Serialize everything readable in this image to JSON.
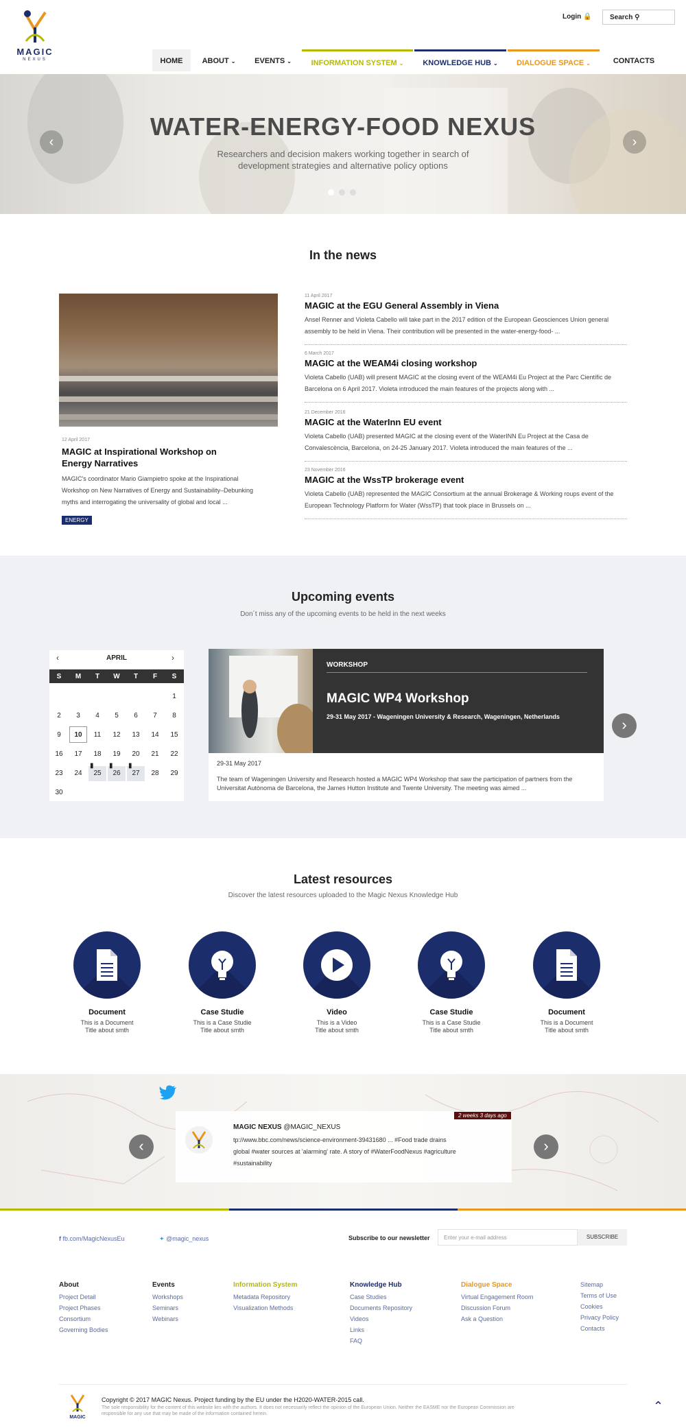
{
  "header": {
    "logo_word": "MAGIC",
    "logo_sub": "NEXUS",
    "login_label": "Login",
    "search_label": "Search",
    "nav": [
      {
        "label": "HOME",
        "color": "#222222"
      },
      {
        "label": "ABOUT",
        "color": "#222222"
      },
      {
        "label": "EVENTS",
        "color": "#222222"
      },
      {
        "label": "INFORMATION SYSTEM",
        "color": "#b7b900"
      },
      {
        "label": "KNOWLEDGE HUB",
        "color": "#1c2d6b"
      },
      {
        "label": "DIALOGUE SPACE",
        "color": "#e8961e"
      },
      {
        "label": "CONTACTS",
        "color": "#222222"
      }
    ]
  },
  "hero": {
    "title": "WATER-ENERGY-FOOD NEXUS",
    "subtitle": "Researchers and decision makers working together in search of development strategies and alternative policy options",
    "slide_current": 1,
    "slide_count": 3
  },
  "news": {
    "title": "In the news",
    "featured": {
      "date": "12 April 2017",
      "title": "MAGIC at Inspirational Workshop on Energy Narratives",
      "text": "MAGIC's coordinator Mario Giampietro spoke at the Inspirational Workshop on New Narratives of Energy and Sustainability–Debunking myths and interrogating the universality of global and local ...",
      "tag": "ENERGY"
    },
    "items": [
      {
        "date": "11 April 2017",
        "title": "MAGIC at the EGU General Assembly in Viena",
        "text": "Ansel Renner and Violeta Cabello will take part in the 2017 edition of the European Geosciences Union general assembly to be held in Viena. Their contribution will be presented in the water-energy-food- ..."
      },
      {
        "date": "6 March 2017",
        "title": "MAGIC at the WEAM4i closing workshop",
        "text": "Violeta Cabello (UAB) will present MAGIC at the closing event of the WEAM4i Eu Project at the Parc Científic de Barcelona on 6 April 2017. Violeta introduced the main features of the projects along with ..."
      },
      {
        "date": "21 December 2016",
        "title": "MAGIC at the WaterInn EU event",
        "text": "Violeta Cabello (UAB) presented MAGIC at the closing event of the WaterINN Eu Project at the Casa de Convalescència, Barcelona, on 24-25 January 2017. Violeta introduced the main features of the ..."
      },
      {
        "date": "23 November 2016",
        "title": "MAGIC at the WssTP brokerage event",
        "text": "Violeta Cabello (UAB) represented the MAGIC Consortium at the annual Brokerage & Working roups event of the European Technology Platform for Water (WssTP) that took place in Brussels on ..."
      }
    ]
  },
  "events": {
    "title": "Upcoming events",
    "subtitle": "Don´t miss any of the upcoming events to be held in the next weeks",
    "calendar": {
      "month": "APRIL",
      "weekdays": [
        "S",
        "M",
        "T",
        "W",
        "T",
        "F",
        "S"
      ],
      "today": "10",
      "event_days": [
        "25",
        "26",
        "27"
      ]
    },
    "card": {
      "tag": "WORKSHOP",
      "title": "MAGIC WP4 Workshop",
      "details": "29-31 May 2017 - Wageningen University & Research, Wageningen, Netherlands",
      "date": "29-31 May 2017",
      "text": "The team of Wageningen University and Research hosted a MAGIC WP4 Workshop that saw the participation of partners from the Universitat Autònoma de Barcelona, the James Hutton Institute and Twente University. The meeting was aimed ..."
    }
  },
  "resources": {
    "title": "Latest resources",
    "subtitle": "Discover the latest resources uploaded to the Magic Nexus Knowledge Hub",
    "items": [
      {
        "icon": "document-icon",
        "label": "Document",
        "sub1": "This is a Document",
        "sub2": "Title about smth"
      },
      {
        "icon": "lightbulb-icon",
        "label": "Case Studie",
        "sub1": "This is a Case Studie",
        "sub2": "Title about smth"
      },
      {
        "icon": "play-icon",
        "label": "Video",
        "sub1": "This is a Video",
        "sub2": "Title about smth"
      },
      {
        "icon": "lightbulb-icon",
        "label": "Case Studie",
        "sub1": "This is a Case Studie",
        "sub2": "Title about smth"
      },
      {
        "icon": "document-icon",
        "label": "Document",
        "sub1": "This is a Document",
        "sub2": "Title about smth"
      }
    ]
  },
  "twitter": {
    "time": "2 weeks 3 days ago",
    "name": "MAGIC NEXUS",
    "handle": "@MAGIC_NEXUS",
    "text": "tp://www.bbc.com/news/science-environment-39431680 ... #Food trade drains global #water sources at 'alarming' rate. A story of #WaterFoodNexus #agriculture #sustainability"
  },
  "footer": {
    "fb": "fb.com/MagicNexusEu",
    "tw": "@magic_nexus",
    "newsletter_label": "Subscribe to our newsletter",
    "newsletter_placeholder": "Enter your e-mail address",
    "subscribe": "SUBSCRIBE",
    "columns": [
      {
        "head": "About",
        "color": "#222222",
        "links": [
          "Project Detail",
          "Project Phases",
          "Consortium",
          "Governing Bodies"
        ]
      },
      {
        "head": "Events",
        "color": "#222222",
        "links": [
          "Workshops",
          "Seminars",
          "Webinars"
        ]
      },
      {
        "head": "Information System",
        "color": "#b7b900",
        "links": [
          "Metadata Repository",
          "Visualization Methods"
        ]
      },
      {
        "head": "Knowledge Hub",
        "color": "#1c2d6b",
        "links": [
          "Case Studies",
          "Documents Repository",
          "Videos",
          "Links",
          "FAQ"
        ]
      },
      {
        "head": "Dialogue Space",
        "color": "#e8961e",
        "links": [
          "Virtual Engagement Room",
          "Discussion Forum",
          "Ask a Question"
        ]
      },
      {
        "head": "",
        "color": "#222222",
        "links": [
          "Sitemap",
          "Terms of Use",
          "Cookies",
          "Privacy Policy",
          "Contacts"
        ]
      }
    ],
    "copyright": "Copyright © 2017 MAGIC Nexus. Project funding by the EU under the H2020-WATER-2015 call.",
    "disclaimer": "The sole responsibility for the content of this website lies with the authors. It does not necessarily reflect the opinion of the European Union. Neither the EASME nor the European Commission are responsible for any use that may be made of the information contained herein."
  },
  "colors": {
    "brand_blue": "#1c2d6b",
    "info_yellow": "#b7b900",
    "dialogue_orange": "#e8961e",
    "twitter_blue": "#1da1f2"
  }
}
